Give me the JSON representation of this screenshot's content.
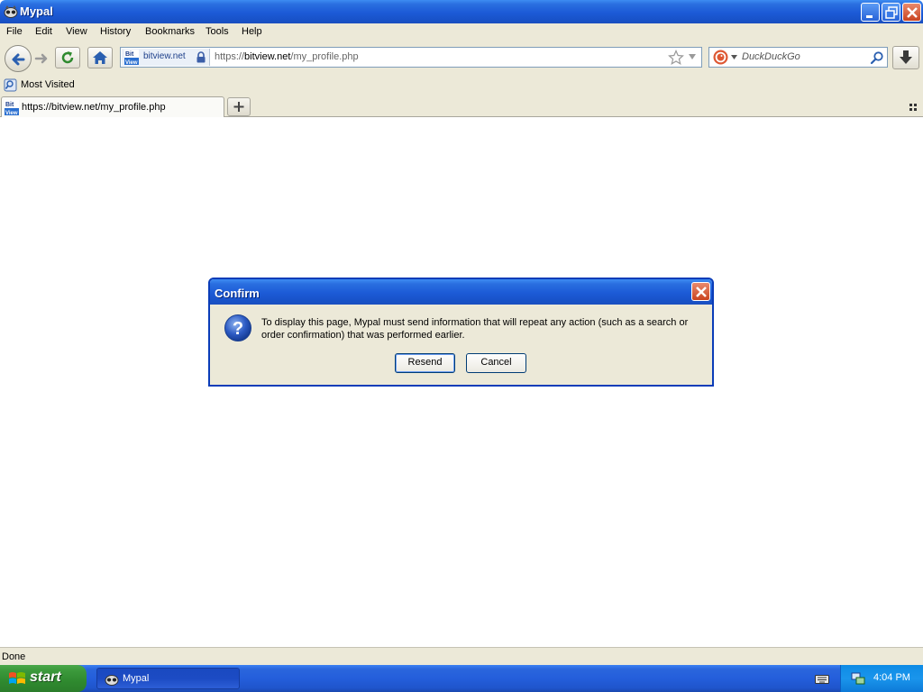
{
  "window": {
    "title": "Mypal"
  },
  "menu": {
    "items": [
      {
        "label": "File"
      },
      {
        "label": "Edit"
      },
      {
        "label": "View"
      },
      {
        "label": "History"
      },
      {
        "label": "Bookmarks"
      },
      {
        "label": "Tools"
      },
      {
        "label": "Help"
      }
    ]
  },
  "navbar": {
    "identity_label": "bitview.net",
    "site_logo_text": "Bit View",
    "url_prefix": "https://",
    "url_domain": "bitview.net",
    "url_path": "/my_profile.php",
    "search_placeholder": "DuckDuckGo"
  },
  "bookmarks": {
    "items": [
      {
        "label": "Most Visited"
      }
    ]
  },
  "tabs": [
    {
      "label": "https://bitview.net/my_profile.php"
    }
  ],
  "dialog": {
    "title": "Confirm",
    "message": "To display this page, Mypal must send information that will repeat any action (such as a search or order confirmation) that was performed earlier.",
    "buttons": {
      "resend": "Resend",
      "cancel": "Cancel"
    }
  },
  "status": {
    "text": "Done"
  },
  "taskbar": {
    "start_label": "start",
    "task_label": "Mypal",
    "clock": "4:04 PM"
  },
  "colors": {
    "titlebar_blue": "#1c5ad6",
    "chrome_beige": "#ece9d8",
    "start_green": "#3c9a3c",
    "tray_blue": "#1a95ec"
  }
}
